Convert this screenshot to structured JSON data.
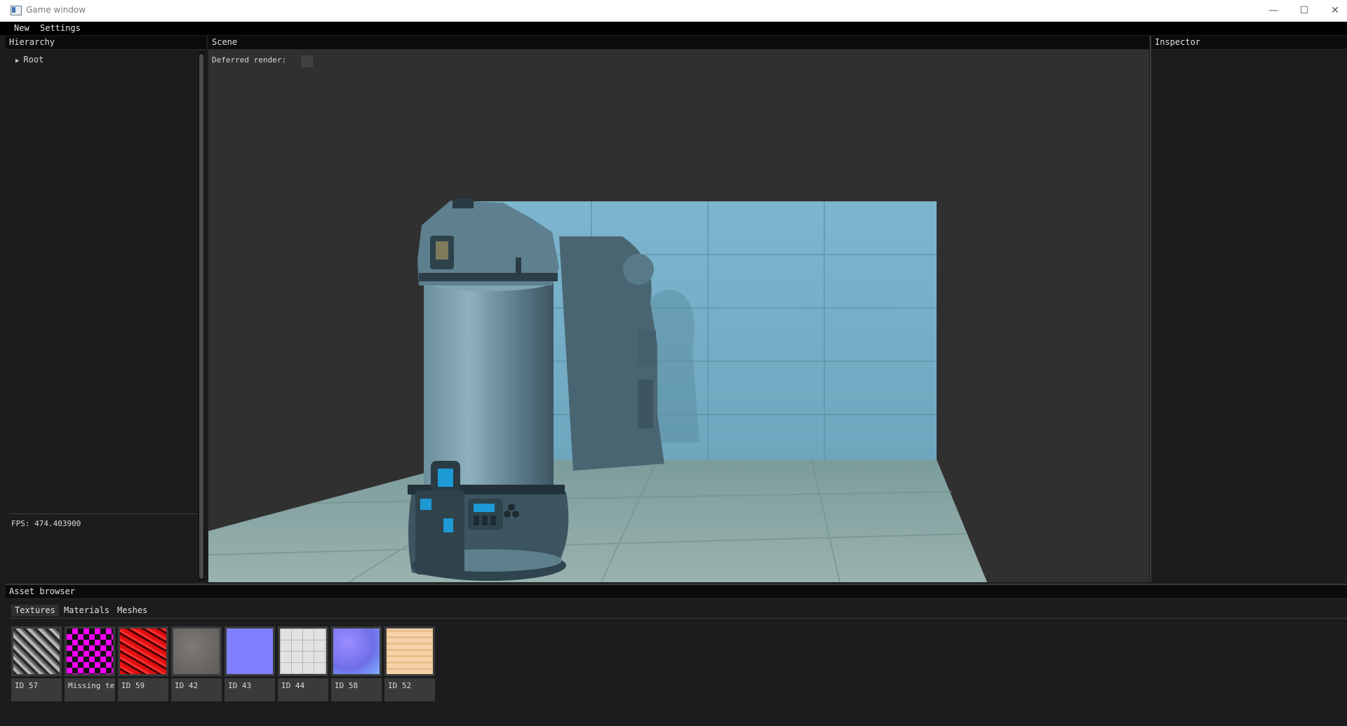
{
  "window": {
    "title": "Game window",
    "controls": {
      "minimize": "—",
      "maximize": "☐",
      "close": "✕"
    }
  },
  "menubar": {
    "items": [
      "New",
      "Settings"
    ]
  },
  "hierarchy": {
    "title": "Hierarchy",
    "tree": [
      {
        "label": "Root",
        "expanded": false
      }
    ],
    "fps": "FPS: 474.403900"
  },
  "scene": {
    "title": "Scene",
    "deferred_render_label": "Deferred render:",
    "deferred_render_checked": false
  },
  "inspector": {
    "title": "Inspector"
  },
  "asset_browser": {
    "title": "Asset browser",
    "tabs": [
      {
        "label": "Textures",
        "active": true
      },
      {
        "label": "Materials",
        "active": false
      },
      {
        "label": "Meshes",
        "active": false
      }
    ],
    "assets": [
      {
        "label": "ID 57",
        "icon": "texture-mechanical-gray"
      },
      {
        "label": "Missing te",
        "icon": "texture-missing-checker"
      },
      {
        "label": "ID 59",
        "icon": "texture-red-noise"
      },
      {
        "label": "ID 42",
        "icon": "texture-gray-concrete"
      },
      {
        "label": "ID 43",
        "icon": "texture-flat-normal"
      },
      {
        "label": "ID 44",
        "icon": "texture-white-tiles"
      },
      {
        "label": "ID 58",
        "icon": "texture-normal-map"
      },
      {
        "label": "ID 52",
        "icon": "texture-wood"
      }
    ]
  },
  "colors": {
    "panel_bg": "#1b1c1e",
    "header_bg": "#0b0b0c",
    "scene_bg": "#303030",
    "wall": "#78aec6",
    "floor": "#86a6a8",
    "accent_blue": "#1e9ad6"
  }
}
